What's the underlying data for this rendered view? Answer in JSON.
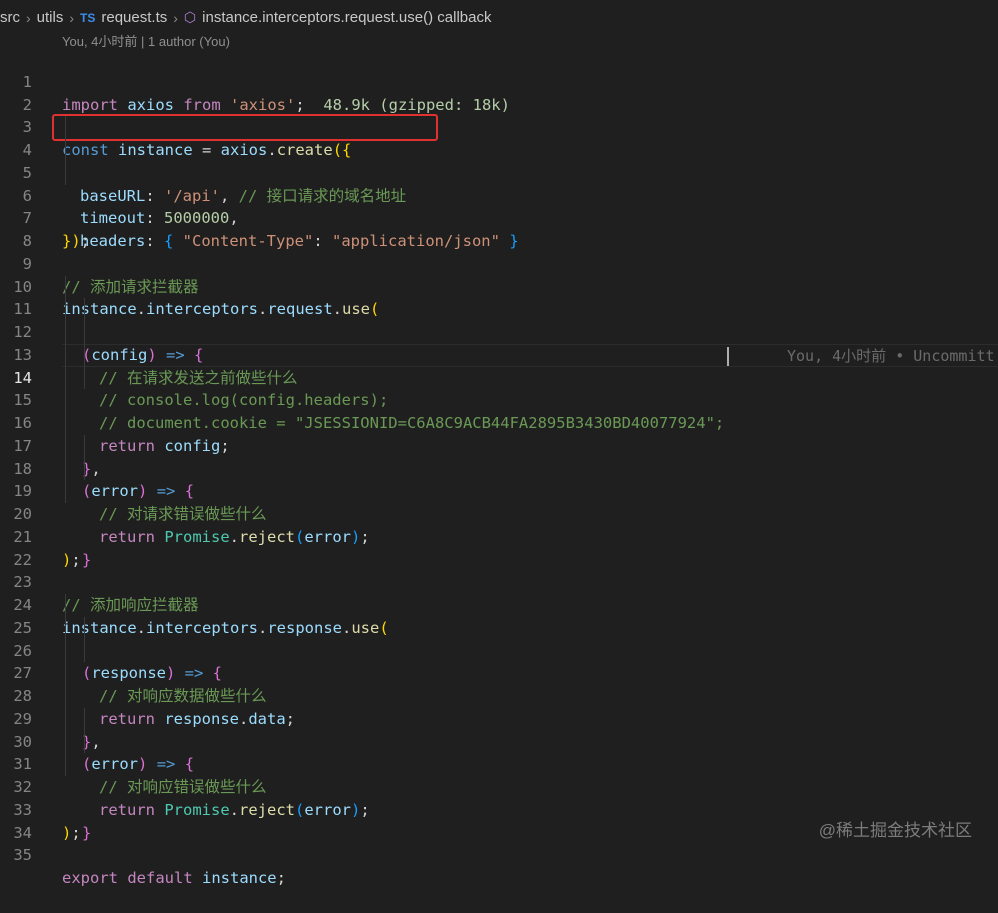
{
  "breadcrumb": {
    "items": [
      "src",
      "utils",
      "request.ts",
      "instance.interceptors.request.use() callback"
    ],
    "ts_badge": "TS"
  },
  "blame_header": "You, 4小时前 | 1 author (You)",
  "inline_blame": "You, 4小时前 • Uncommitt",
  "watermark": "@稀土掘金技术社区",
  "colors": {
    "background": "#1f1f1f",
    "keyword": "#569cd6",
    "string": "#ce9178",
    "comment": "#6a9955",
    "highlight_box": "#e03131"
  },
  "editor": {
    "current_line": 14,
    "lines": [
      {
        "n": "1",
        "t": {
          "a": "import",
          "b": " axios ",
          "c": "from",
          "d": " 'axios'",
          "e": ";",
          "f": "  48.9k (gzipped: 18k)"
        }
      },
      {
        "n": "2"
      },
      {
        "n": "3",
        "t": {
          "a": "const",
          "b": " instance",
          "c": " = ",
          "d": "axios",
          "e": ".",
          "f": "create",
          "g": "({"
        }
      },
      {
        "n": "4",
        "t": {
          "a": "baseURL",
          "b": ": ",
          "c": "'/api'",
          "d": ", ",
          "e": "// 接口请求的域名地址"
        }
      },
      {
        "n": "5",
        "t": {
          "a": "timeout",
          "b": ": ",
          "c": "5000000",
          "d": ","
        }
      },
      {
        "n": "6",
        "t": {
          "a": "headers",
          "b": ": ",
          "c": "{",
          "d": " \"Content-Type\"",
          "e": ": ",
          "f": "\"application/json\"",
          "g": " }"
        }
      },
      {
        "n": "7",
        "t": {
          "a": "})",
          "b": ";"
        }
      },
      {
        "n": "8"
      },
      {
        "n": "9",
        "t": {
          "a": "// 添加请求拦截器"
        }
      },
      {
        "n": "10",
        "t": {
          "a": "instance",
          "b": ".",
          "c": "interceptors",
          "d": ".",
          "e": "request",
          "f": ".",
          "g": "use",
          "h": "("
        }
      },
      {
        "n": "11",
        "t": {
          "a": "(",
          "b": "config",
          "c": ")",
          "d": " => ",
          "e": "{"
        }
      },
      {
        "n": "12",
        "t": {
          "a": "// 在请求发送之前做些什么"
        }
      },
      {
        "n": "13",
        "t": {
          "a": "// console.log(config.headers);"
        }
      },
      {
        "n": "14",
        "t": {
          "a": "// document.cookie = \"JSESSIONID=C6A8C9ACB44FA2895B3430BD40077924\";"
        }
      },
      {
        "n": "15",
        "t": {
          "a": "return",
          "b": " config",
          "c": ";"
        }
      },
      {
        "n": "16",
        "t": {
          "a": "}",
          "b": ","
        }
      },
      {
        "n": "17",
        "t": {
          "a": "(",
          "b": "error",
          "c": ")",
          "d": " => ",
          "e": "{"
        }
      },
      {
        "n": "18",
        "t": {
          "a": "// 对请求错误做些什么"
        }
      },
      {
        "n": "19",
        "t": {
          "a": "return",
          "b": " Promise",
          "c": ".",
          "d": "reject",
          "e": "(",
          "f": "error",
          "g": ")",
          "h": ";"
        }
      },
      {
        "n": "20",
        "t": {
          "a": "}"
        }
      },
      {
        "n": "21",
        "t": {
          "a": ")",
          "b": ";"
        }
      },
      {
        "n": "22"
      },
      {
        "n": "23",
        "t": {
          "a": "// 添加响应拦截器"
        }
      },
      {
        "n": "24",
        "t": {
          "a": "instance",
          "b": ".",
          "c": "interceptors",
          "d": ".",
          "e": "response",
          "f": ".",
          "g": "use",
          "h": "("
        }
      },
      {
        "n": "25",
        "t": {
          "a": "(",
          "b": "response",
          "c": ")",
          "d": " => ",
          "e": "{"
        }
      },
      {
        "n": "26",
        "t": {
          "a": "// 对响应数据做些什么"
        }
      },
      {
        "n": "27",
        "t": {
          "a": "return",
          "b": " response",
          "c": ".",
          "d": "data",
          "e": ";"
        }
      },
      {
        "n": "28",
        "t": {
          "a": "}",
          "b": ","
        }
      },
      {
        "n": "29",
        "t": {
          "a": "(",
          "b": "error",
          "c": ")",
          "d": " => ",
          "e": "{"
        }
      },
      {
        "n": "30",
        "t": {
          "a": "// 对响应错误做些什么"
        }
      },
      {
        "n": "31",
        "t": {
          "a": "return",
          "b": " Promise",
          "c": ".",
          "d": "reject",
          "e": "(",
          "f": "error",
          "g": ")",
          "h": ";"
        }
      },
      {
        "n": "32",
        "t": {
          "a": "}"
        }
      },
      {
        "n": "33",
        "t": {
          "a": ")",
          "b": ";"
        }
      },
      {
        "n": "34"
      },
      {
        "n": "35",
        "t": {
          "a": "export",
          "b": " default",
          "c": " instance",
          "d": ";"
        }
      }
    ]
  }
}
